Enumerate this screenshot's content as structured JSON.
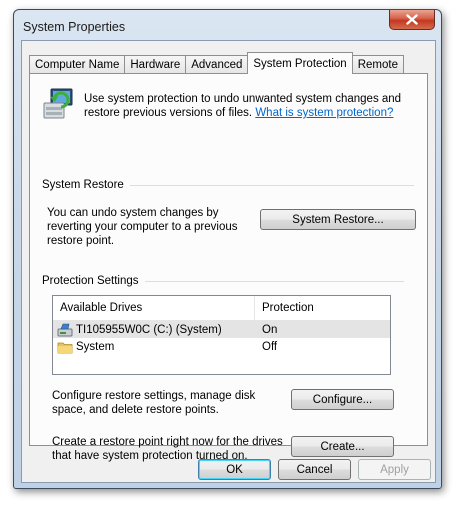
{
  "window": {
    "title": "System Properties"
  },
  "tabs": [
    {
      "label": "Computer Name"
    },
    {
      "label": "Hardware"
    },
    {
      "label": "Advanced"
    },
    {
      "label": "System Protection"
    },
    {
      "label": "Remote"
    }
  ],
  "active_tab": "System Protection",
  "intro": {
    "text": "Use system protection to undo unwanted system changes and restore previous versions of files.",
    "link": "What is system protection?"
  },
  "system_restore": {
    "group_label": "System Restore",
    "description": "You can undo system changes by reverting your computer to a previous restore point.",
    "button_label": "System Restore..."
  },
  "protection_settings": {
    "group_label": "Protection Settings",
    "columns": [
      "Available Drives",
      "Protection"
    ],
    "drives": [
      {
        "name": "TI105955W0C (C:) (System)",
        "protection": "On",
        "icon": "local-disk-icon",
        "selected": true
      },
      {
        "name": "System",
        "protection": "Off",
        "icon": "folder-icon",
        "selected": false
      }
    ],
    "configure_text": "Configure restore settings, manage disk space, and delete restore points.",
    "configure_button": "Configure...",
    "create_text": "Create a restore point right now for the drives that have system protection turned on.",
    "create_button": "Create..."
  },
  "footer": {
    "ok": "OK",
    "cancel": "Cancel",
    "apply": "Apply"
  },
  "colors": {
    "link": "#0066cc",
    "close_button": "#c2381f",
    "selected_row": "#e4e4e4"
  }
}
